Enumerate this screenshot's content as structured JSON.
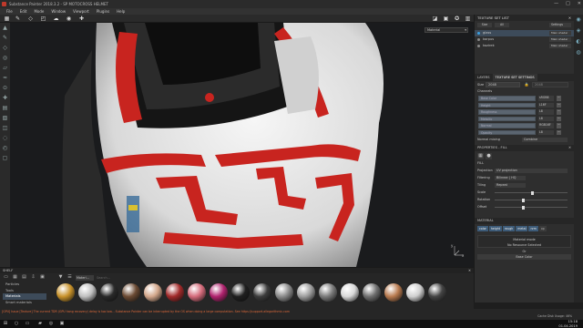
{
  "window": {
    "title": "Substance Painter 2018.3.2 - SP MOTOCROSS HELMET",
    "controls": [
      "—",
      "□",
      "✕"
    ]
  },
  "menu": [
    "File",
    "Edit",
    "Mode",
    "Window",
    "Viewport",
    "Plugins",
    "Help"
  ],
  "viewport": {
    "display_mode": "Material",
    "axis_labels": [
      "y",
      "x"
    ]
  },
  "texture_set_list": {
    "title": "TEXTURE SET LIST",
    "tab_1": "Size",
    "tab_2": "All",
    "settings": "Settings",
    "items": [
      {
        "name": "glass",
        "shader": "Main shader"
      },
      {
        "name": "korpus",
        "shader": "Main shader"
      },
      {
        "name": "kozirek",
        "shader": "Main shader"
      }
    ]
  },
  "layers_tabs": {
    "layers": "LAYERS",
    "tss": "TEXTURE SET SETTINGS"
  },
  "texture_set_settings": {
    "size_label": "Size",
    "size_value": "2048",
    "size_value_2": "2048",
    "channels_label": "Channels",
    "channels": [
      {
        "name": "Base Color",
        "format": "sRGB8"
      },
      {
        "name": "Height",
        "format": "L16F"
      },
      {
        "name": "Roughness",
        "format": "L8"
      },
      {
        "name": "Metallic",
        "format": "L8"
      },
      {
        "name": "Normal",
        "format": "RGB16F"
      },
      {
        "name": "Opacity",
        "format": "L8"
      }
    ],
    "normal_mixing_label": "Normal mixing",
    "normal_mixing_value": "Combine"
  },
  "properties": {
    "title": "PROPERTIES - FILL",
    "fill_label": "FILL",
    "projection_label": "Projection",
    "projection_value": "UV projection",
    "filtering_label": "Filtering",
    "filtering_value": "Bilinear | HQ",
    "tiling_label": "Tiling",
    "tiling_value": "Repeat",
    "scale_label": "Scale",
    "rotation_label": "Rotation",
    "offset_label": "Offset",
    "material_label": "MATERIAL",
    "material_buttons": [
      "color",
      "height",
      "rough",
      "metal",
      "nrm",
      "op"
    ],
    "material_mode": "Material mode",
    "no_resource": "No Resource Selected",
    "or_text": "Or",
    "base_color": "Base Color"
  },
  "shelf": {
    "title": "SHELF",
    "filter_chip": "Materi...",
    "search_placeholder": "Search...",
    "categories": [
      "Particles",
      "Tools",
      "Materials",
      "Smart materials"
    ],
    "materials": [
      {
        "name": "gold",
        "color": "#c8922a"
      },
      {
        "name": "chrome",
        "color": "#bfbfbf"
      },
      {
        "name": "dark-plastic",
        "color": "#2a2a2a"
      },
      {
        "name": "leather",
        "color": "#6b4a33"
      },
      {
        "name": "skin",
        "color": "#d2a68a"
      },
      {
        "name": "red-plastic",
        "color": "#a22a2a"
      },
      {
        "name": "pink",
        "color": "#d46a7a"
      },
      {
        "name": "magenta",
        "color": "#b0226e"
      },
      {
        "name": "black-rubber",
        "color": "#1f1f1f"
      },
      {
        "name": "dark-metal",
        "color": "#3c3c3c"
      },
      {
        "name": "steel",
        "color": "#8a8a8a"
      },
      {
        "name": "brushed",
        "color": "#9d9d9d"
      },
      {
        "name": "concrete",
        "color": "#7a7a7a"
      },
      {
        "name": "white",
        "color": "#d8d8d8"
      },
      {
        "name": "gray",
        "color": "#6e6e6e"
      },
      {
        "name": "copper",
        "color": "#b87a4f"
      },
      {
        "name": "silver",
        "color": "#cfcfcf"
      },
      {
        "name": "graphite",
        "color": "#444444"
      }
    ]
  },
  "status": {
    "message": "[GPU] Issue [Texture] The current TDR (GPU hang recovery) delay is too low... Substance Painter can be interrupted by the OS when doing a large computation. See https://support.allegorithmic.com",
    "cache": "Cache Disk Usage: 46%"
  },
  "taskbar": {
    "time": "15:18",
    "date": "01.04.2019"
  },
  "colors": {
    "accent": "#3aa0e0",
    "helmet_red": "#c8241f",
    "helmet_white": "#f2f2f2"
  }
}
